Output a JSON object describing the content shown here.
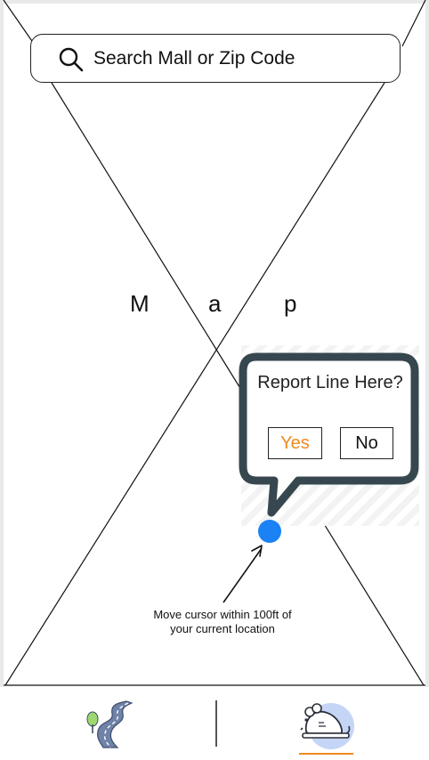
{
  "search": {
    "placeholder": "Search Mall or Zip Code",
    "icon": "search-icon"
  },
  "map": {
    "letters": [
      "M",
      "a",
      "p"
    ]
  },
  "report_popup": {
    "title": "Report Line Here?",
    "yes_label": "Yes",
    "no_label": "No",
    "yes_color": "#f08a1e"
  },
  "location": {
    "dot_color": "#1a82f5",
    "hint": "Move cursor within 100ft of your current location"
  },
  "tabs": [
    {
      "icon": "road-icon",
      "selected": false
    },
    {
      "icon": "mouse-icon",
      "selected": true
    }
  ],
  "accent_color": "#f08a1e"
}
